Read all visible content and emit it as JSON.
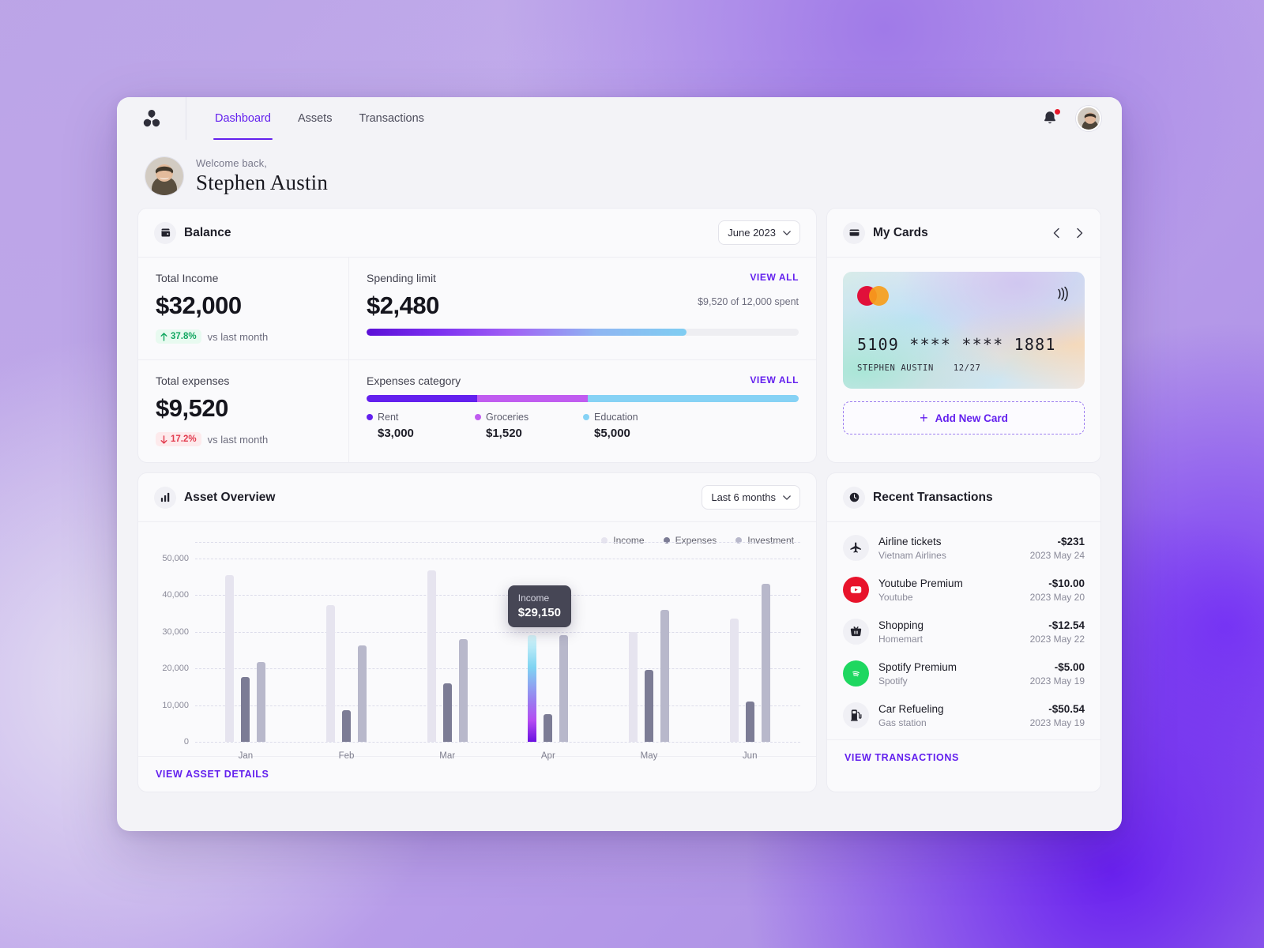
{
  "topbar": {
    "logo_name": "trefoil-logo",
    "tabs": [
      {
        "label": "Dashboard",
        "active": true
      },
      {
        "label": "Assets",
        "active": false
      },
      {
        "label": "Transactions",
        "active": false
      }
    ],
    "notification_badge": true
  },
  "welcome": {
    "greeting": "Welcome back,",
    "name": "Stephen Austin"
  },
  "balance": {
    "title": "Balance",
    "period": "June 2023",
    "total_income": {
      "label": "Total Income",
      "amount": "$32,000",
      "delta": "37.8%",
      "delta_direction": "up",
      "delta_note": "vs last month"
    },
    "total_expenses": {
      "label": "Total expenses",
      "amount": "$9,520",
      "delta": "17.2%",
      "delta_direction": "down",
      "delta_note": "vs last month"
    },
    "spending_limit": {
      "label": "Spending limit",
      "amount": "$2,480",
      "view_all": "VIEW ALL",
      "spent_note": "$9,520 of 12,000 spent",
      "progress_percent": 74
    },
    "expenses_category": {
      "label": "Expenses category",
      "view_all": "VIEW ALL",
      "items": [
        {
          "name": "Rent",
          "value": "$3,000",
          "color": "#6320ee",
          "percent": 25.6
        },
        {
          "name": "Groceries",
          "value": "$1,520",
          "color": "#c05cf0",
          "percent": 25.6
        },
        {
          "name": "Education",
          "value": "$5,000",
          "color": "#86d2f5",
          "percent": 48.8
        }
      ]
    }
  },
  "my_cards": {
    "title": "My Cards",
    "prev_label": "previous card",
    "next_label": "next card",
    "card": {
      "brand": "mastercard",
      "number": "5109 **** **** 1881",
      "holder": "STEPHEN AUSTIN",
      "expiry": "12/27"
    },
    "add_card_label": "Add New Card"
  },
  "asset_overview": {
    "title": "Asset Overview",
    "range": "Last 6 months",
    "footer_link": "VIEW ASSET DETAILS",
    "tooltip": {
      "label": "Income",
      "value": "$29,150"
    }
  },
  "chart_data": {
    "type": "bar",
    "title": "Asset Overview",
    "xlabel": "",
    "ylabel": "",
    "ylim": [
      0,
      50000
    ],
    "grid": true,
    "legend_position": "top-right",
    "yticks": [
      "0",
      "10,000",
      "20,000",
      "30,000",
      "40,000",
      "50,000"
    ],
    "ytick_values": [
      0,
      10000,
      20000,
      30000,
      40000,
      50000
    ],
    "categories": [
      "Jan",
      "Feb",
      "Mar",
      "Apr",
      "May",
      "Jun"
    ],
    "series": [
      {
        "name": "Income",
        "color": "#e6e4ef",
        "values": [
          45500,
          37200,
          46800,
          29150,
          30000,
          33700
        ]
      },
      {
        "name": "Expenses",
        "color": "#7c7c95",
        "values": [
          17700,
          8700,
          16000,
          7500,
          19700,
          11000
        ]
      },
      {
        "name": "Investment",
        "color": "#b8b8cb",
        "values": [
          21800,
          26400,
          28000,
          29200,
          36000,
          43000
        ]
      }
    ],
    "highlight": {
      "category": "Apr",
      "series": "Income",
      "value": 29150,
      "label": "Income",
      "value_label": "$29,150"
    },
    "annotations": [
      {
        "text": "Income $29,150",
        "at": "Apr/Income"
      }
    ]
  },
  "recent_transactions": {
    "title": "Recent Transactions",
    "footer_link": "VIEW TRANSACTIONS",
    "items": [
      {
        "name": "Airline tickets",
        "merchant": "Vietnam Airlines",
        "amount": "-$231",
        "date": "2023 May 24",
        "icon": "airplane-icon",
        "icon_style": "plain"
      },
      {
        "name": "Youtube Premium",
        "merchant": "Youtube",
        "amount": "-$10.00",
        "date": "2023 May 20",
        "icon": "youtube-icon",
        "icon_style": "yt"
      },
      {
        "name": "Shopping",
        "merchant": "Homemart",
        "amount": "-$12.54",
        "date": "2023 May 22",
        "icon": "basket-icon",
        "icon_style": "plain"
      },
      {
        "name": "Spotify Premium",
        "merchant": "Spotify",
        "amount": "-$5.00",
        "date": "2023 May 19",
        "icon": "spotify-icon",
        "icon_style": "sp"
      },
      {
        "name": "Car Refueling",
        "merchant": "Gas station",
        "amount": "-$50.54",
        "date": "2023 May 19",
        "icon": "fuel-pump-icon",
        "icon_style": "plain"
      }
    ]
  },
  "colors": {
    "accent": "#6320ee",
    "positive": "#12a760",
    "negative": "#e23b4e",
    "surface": "#fafafc",
    "window": "#f3f3f7"
  }
}
